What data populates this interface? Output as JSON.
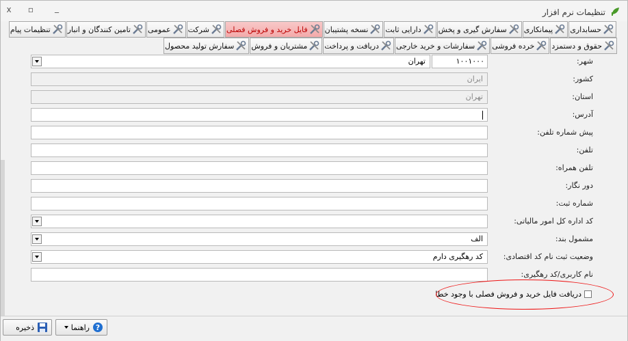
{
  "window": {
    "title": "تنظیمات نرم افزار",
    "close_glyph": "x",
    "restore_glyph": "▫",
    "min_glyph": "_"
  },
  "tabs_row1": [
    "حسابداری",
    "پیمانکاری",
    "سفارش گیری و پخش",
    "دارایی ثابت",
    "نسخه پشتیبان",
    "فایل خرید و فروش فصلی",
    "شرکت",
    "عمومی",
    "تامین کنندگان و انبار",
    "تنظیمات پیام"
  ],
  "tabs_row2": [
    "حقوق و دستمزد",
    "خرده فروشی",
    "سفارشات و خرید خارجی",
    "دریافت و پرداخت",
    "مشتریان و فروش",
    "سفارش تولید محصول"
  ],
  "active_tab": "فایل خرید و فروش فصلی",
  "form": {
    "city_label": "شهر:",
    "city_value": "تهران",
    "city_code": "۱۰۰۱۰۰۰",
    "country_label": "کشور:",
    "country_value": "ایران",
    "province_label": "استان:",
    "province_value": "تهران",
    "address_label": "آدرس:",
    "address_value": "",
    "phone_prefix_label": "پیش شماره تلفن:",
    "phone_label": "تلفن:",
    "mobile_label": "تلفن همراه:",
    "fax_label": "دور نگار:",
    "reg_no_label": "شماره ثبت:",
    "tax_office_label": "کد اداره کل امور مالیاتی:",
    "tax_office_value": "",
    "subject_label": "مشمول بند:",
    "subject_value": "الف",
    "econ_status_label": "وضعیت ثبت نام کد اقتصادی:",
    "econ_status_value": "کد رهگیری دارم",
    "username_label": "نام کاربری/کد رهگیری:"
  },
  "checkbox": {
    "label": "دریافت فایل خرید و فروش فصلی با وجود خطا",
    "checked": false
  },
  "buttons": {
    "save": "ذخیره",
    "help": "راهنما"
  },
  "colors": {
    "active_tab_bg": "#f3a9a9",
    "active_tab_text": "#bb0000",
    "highlight_ellipse": "#ee1111"
  }
}
